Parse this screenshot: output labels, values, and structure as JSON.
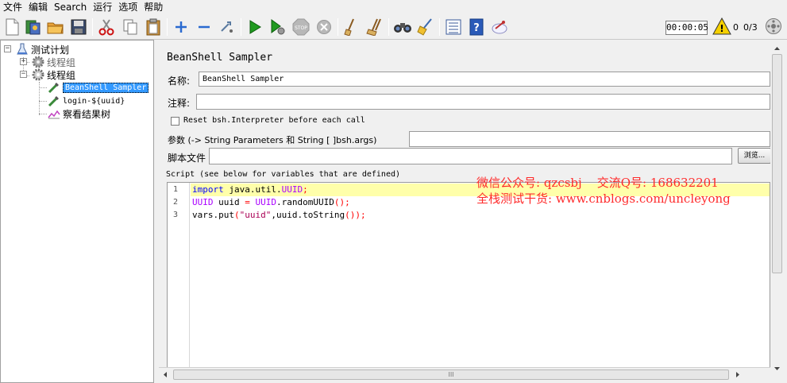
{
  "menu": [
    "文件",
    "编辑",
    "Search",
    "运行",
    "选项",
    "帮助"
  ],
  "toolbar": {
    "timer": "00:00:05",
    "warn_count": "0",
    "thread_ratio": "0/3",
    "icons": [
      "new-icon",
      "templates-icon",
      "open-icon",
      "save-icon",
      "cut-icon",
      "copy-icon",
      "paste-icon",
      "expand-icon",
      "collapse-icon",
      "toggle-icon",
      "start-icon",
      "start-no-pause-icon",
      "stop-icon",
      "shutdown-icon",
      "clear-icon",
      "clear-all-icon",
      "search-icon",
      "reset-search-icon",
      "function-helper-icon",
      "help-icon",
      "remote-icon"
    ]
  },
  "tree": {
    "root": "测试计划",
    "group1": "线程组",
    "group2": "线程组",
    "sampler1": "BeanShell Sampler",
    "sampler2": "login-${uuid}",
    "listener": "察看结果树"
  },
  "panel": {
    "title": "BeanShell Sampler",
    "name_label": "名称:",
    "name_value": "BeanShell Sampler",
    "comment_label": "注释:",
    "comment_value": "",
    "reset_label": "Reset bsh.Interpreter before each call",
    "reset_checked": false,
    "params_label": "参数 (-> String Parameters 和 String [ ]bsh.args)",
    "params_value": "",
    "script_file_label": "脚本文件",
    "script_file_value": "",
    "browse_label": "浏览...",
    "script_label": "Script (see below for variables that are defined)"
  },
  "code": {
    "line_numbers": [
      "1",
      "2",
      "3"
    ]
  },
  "watermark": {
    "line1": "微信公众号: qzcsbj    交流Q号: 168632201",
    "line2": "全栈测试干货: www.cnblogs.com/uncleyong"
  },
  "hscroll_grip": "III"
}
